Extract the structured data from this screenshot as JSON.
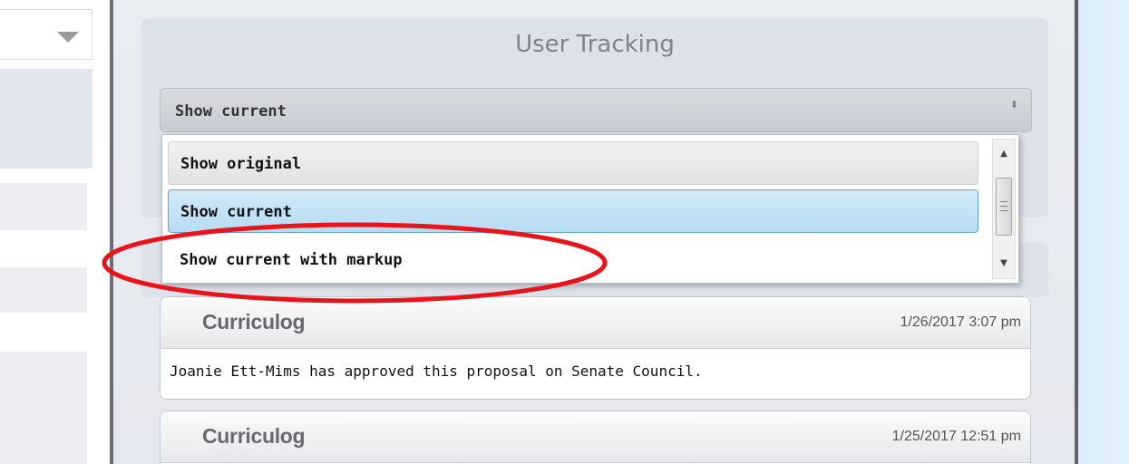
{
  "panel": {
    "title": "User Tracking"
  },
  "view_select": {
    "selected": "Show current",
    "arrow_glyph": "⬍",
    "options": [
      "Show original",
      "Show current",
      "Show current with markup"
    ]
  },
  "scrollbar": {
    "up_glyph": "▲",
    "down_glyph": "▼"
  },
  "entries": [
    {
      "source": "Curriculog",
      "time": "1/26/2017 3:07 pm",
      "message": "Joanie Ett-Mims has approved this proposal on Senate Council."
    },
    {
      "source": "Curriculog",
      "time": "1/25/2017 12:51 pm"
    }
  ],
  "colors": {
    "annotation": "#e8141c",
    "selected_option": "#b6dcf2",
    "selected_option_border": "#5fa6d6"
  }
}
